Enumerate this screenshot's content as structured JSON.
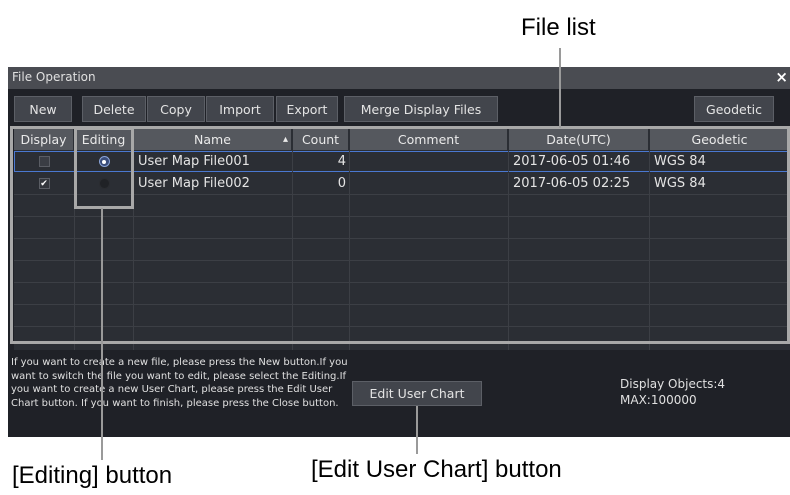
{
  "callouts": {
    "file_list": "File list",
    "editing_button": "[Editing] button",
    "edit_user_chart_button": "[Edit User Chart] button"
  },
  "window": {
    "title": "File Operation",
    "close_glyph": "×"
  },
  "toolbar": {
    "new": "New",
    "delete": "Delete",
    "copy": "Copy",
    "import": "Import",
    "export": "Export",
    "merge": "Merge Display Files",
    "geodetic": "Geodetic"
  },
  "table": {
    "columns": {
      "display": "Display",
      "editing": "Editing",
      "name": "Name",
      "sort_indicator": "▴",
      "count": "Count",
      "comment": "Comment",
      "date": "Date(UTC)",
      "geodetic": "Geodetic"
    },
    "rows": [
      {
        "display_checked": false,
        "editing_selected": true,
        "name": "User Map File001",
        "count": "4",
        "comment": "",
        "date": "2017-06-05 01:46",
        "geodetic": "WGS 84"
      },
      {
        "display_checked": true,
        "editing_selected": false,
        "name": "User Map File002",
        "count": "0",
        "comment": "",
        "date": "2017-06-05 02:25",
        "geodetic": "WGS 84"
      }
    ]
  },
  "footer": {
    "help_text": "If you want to create a new file, please press the New button.If you want to switch the file you want to edit, please select the Editing.If you want to create a new User Chart, please press the Edit User Chart button. If you want to finish, please press the Close button.",
    "edit_user_chart": "Edit User Chart",
    "display_objects": "Display Objects:4",
    "max": "MAX:100000"
  },
  "colors": {
    "window_bg": "#1f2127",
    "header_bg": "#55585e",
    "selection_border": "#4a78d0",
    "callout_line": "#9a9a9a"
  }
}
